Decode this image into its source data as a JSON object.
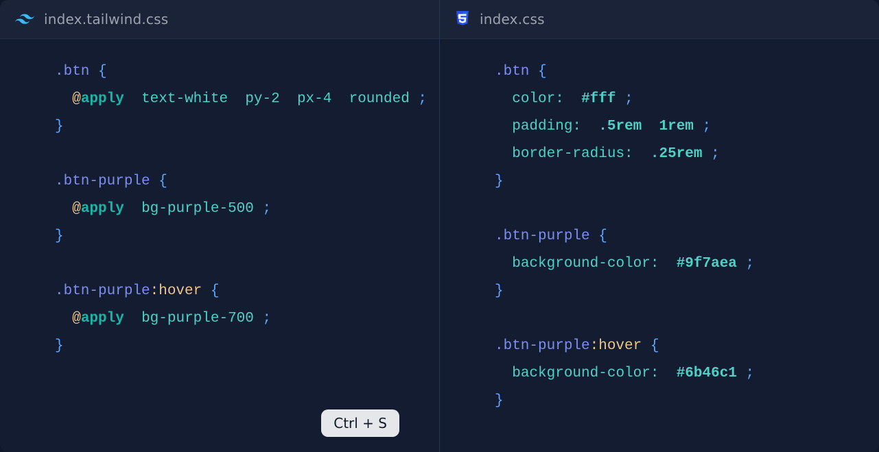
{
  "left": {
    "tab_label": "index.tailwind.css",
    "rule1_sel": ".btn",
    "rule1_at": "@",
    "rule1_apply": "apply",
    "rule1_u1": "text-white",
    "rule1_u2": "py-2",
    "rule1_u3": "px-4",
    "rule1_u4": "rounded",
    "rule2_sel": ".btn-purple",
    "rule2_at": "@",
    "rule2_apply": "apply",
    "rule2_u1": "bg-purple-500",
    "rule3_sel": ".btn-purple",
    "rule3_hover": ":hover",
    "rule3_at": "@",
    "rule3_apply": "apply",
    "rule3_u1": "bg-purple-700"
  },
  "right": {
    "tab_label": "index.css",
    "rule1_sel": ".btn",
    "rule1_p1": "color:",
    "rule1_v1": "#fff",
    "rule1_p2": "padding:",
    "rule1_v2a": ".5rem",
    "rule1_v2b": "1rem",
    "rule1_p3": "border-radius:",
    "rule1_v3": ".25rem",
    "rule2_sel": ".btn-purple",
    "rule2_p1": "background-color:",
    "rule2_v1": "#9f7aea",
    "rule3_sel": ".btn-purple",
    "rule3_hover": ":hover",
    "rule3_p1": "background-color:",
    "rule3_v1": "#6b46c1"
  },
  "keycap": "Ctrl + S"
}
